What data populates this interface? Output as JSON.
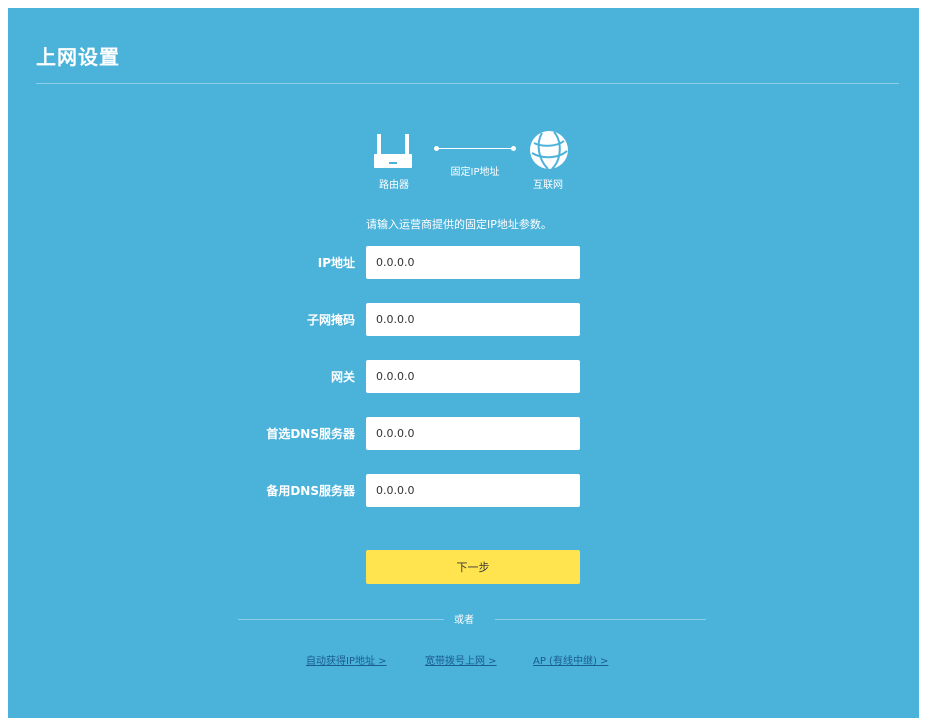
{
  "page": {
    "title": "上网设置"
  },
  "topology": {
    "router_label": "路由器",
    "connection_label": "固定IP地址",
    "internet_label": "互联网"
  },
  "instruction": "请输入运营商提供的固定IP地址参数。",
  "form": {
    "fields": [
      {
        "label": "IP地址",
        "value": "0.0.0.0"
      },
      {
        "label": "子网掩码",
        "value": "0.0.0.0"
      },
      {
        "label": "网关",
        "value": "0.0.0.0"
      },
      {
        "label": "首选DNS服务器",
        "value": "0.0.0.0"
      },
      {
        "label": "备用DNS服务器",
        "value": "0.0.0.0"
      }
    ],
    "next_label": "下一步"
  },
  "alternatives": {
    "or_label": "或者",
    "links": [
      {
        "label": "自动获得IP地址 >"
      },
      {
        "label": "宽带拨号上网 >"
      },
      {
        "label": "AP (有线中继) >"
      }
    ]
  },
  "colors": {
    "background": "#4bb2da",
    "button": "#ffe44f",
    "link": "#1a5d8f"
  },
  "icons": {
    "router": "router-icon",
    "internet": "globe-icon"
  }
}
